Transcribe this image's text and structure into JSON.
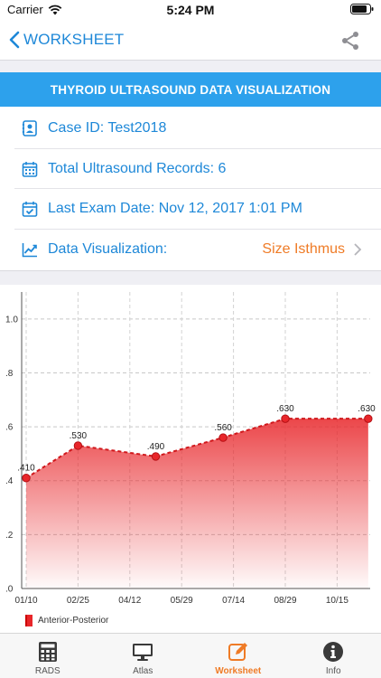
{
  "status": {
    "carrier": "Carrier",
    "time": "5:24 PM"
  },
  "nav": {
    "back_label": "WORKSHEET"
  },
  "header": {
    "title": "THYROID ULTRASOUND DATA VISUALIZATION"
  },
  "info": {
    "case_id": "Case ID: Test2018",
    "total_records": "Total Ultrasound Records: 6",
    "last_exam": "Last Exam Date: Nov 12, 2017  1:01 PM",
    "visualization_label": "Data Visualization:",
    "visualization_value": "Size Isthmus"
  },
  "colors": {
    "accent": "#1e88d8",
    "header_bg": "#2da1ec",
    "orange": "#ef7b26",
    "series": "#e8262a"
  },
  "chart_data": {
    "type": "area",
    "ylim": [
      0,
      1.1
    ],
    "y_ticks": [
      ".0",
      ".2",
      ".4",
      ".6",
      ".8",
      "1.0"
    ],
    "y_tick_values": [
      0,
      0.2,
      0.4,
      0.6,
      0.8,
      1.0
    ],
    "x_ticks": [
      "01/10",
      "02/25",
      "04/12",
      "05/29",
      "07/14",
      "08/29",
      "10/15"
    ],
    "grid": true,
    "legend_position": "bottom-left",
    "series": [
      {
        "name": "Anterior-Posterior",
        "points": [
          {
            "x": "01/10",
            "y": 0.41,
            "label": ".410"
          },
          {
            "x": "02/25",
            "y": 0.53,
            "label": ".530"
          },
          {
            "x": "04/12",
            "y": 0.49,
            "label": ".490",
            "pos": 2.5
          },
          {
            "x": "07/14",
            "y": 0.56,
            "label": ".560",
            "pos": 3.8
          },
          {
            "x": "08/29",
            "y": 0.63,
            "label": ".630",
            "pos": 5.0
          },
          {
            "x": "11/12",
            "y": 0.63,
            "label": ".630",
            "pos": 6.6
          }
        ]
      }
    ]
  },
  "tabs": [
    {
      "label": "RADS",
      "icon": "calculator-icon"
    },
    {
      "label": "Atlas",
      "icon": "monitor-icon"
    },
    {
      "label": "Worksheet",
      "icon": "edit-icon",
      "active": true
    },
    {
      "label": "Info",
      "icon": "info-icon"
    }
  ]
}
